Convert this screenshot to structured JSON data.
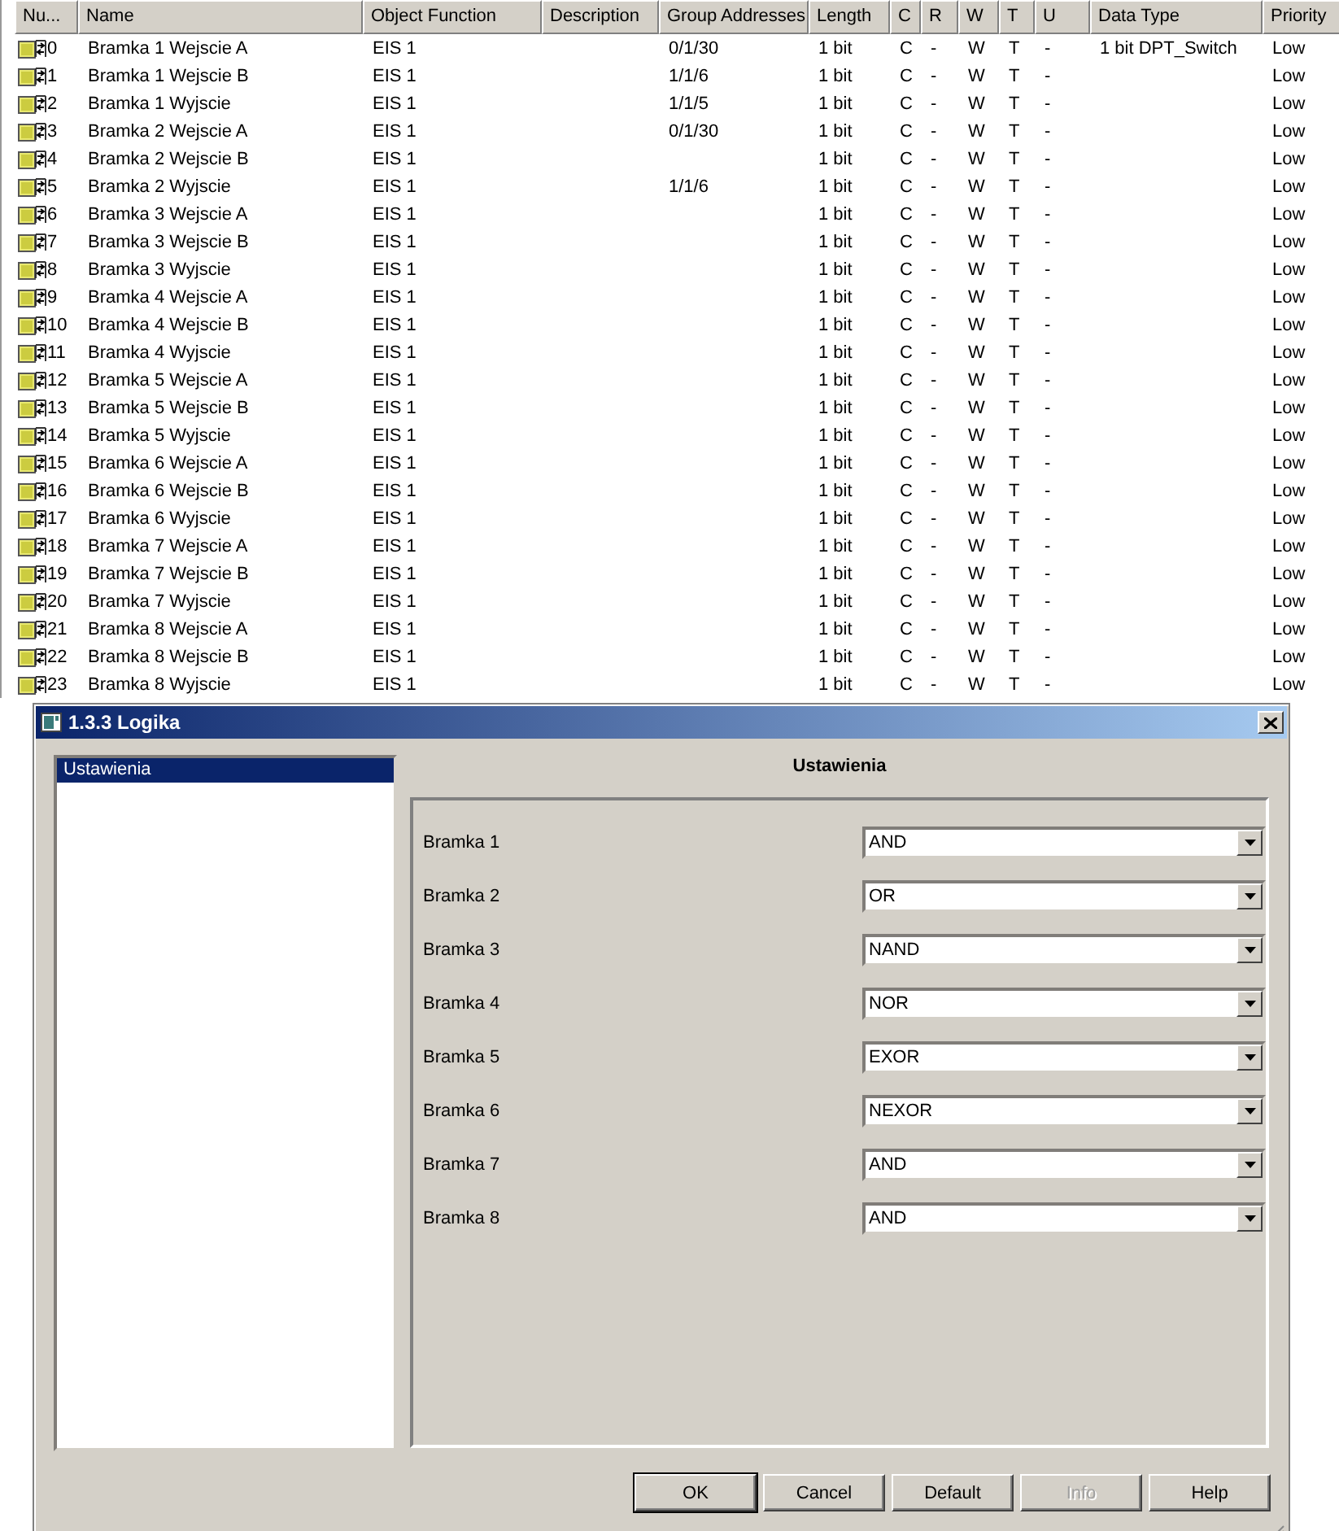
{
  "table": {
    "columns": [
      "Nu...",
      "Name",
      "Object Function",
      "Description",
      "Group Addresses",
      "Length",
      "C",
      "R",
      "W",
      "T",
      "U",
      "Data Type",
      "Priority"
    ],
    "rows": [
      {
        "number": "0",
        "name": "Bramka 1 Wejscie A",
        "function": "EIS 1",
        "group_addresses": "0/1/30",
        "length": "1 bit",
        "c": "C",
        "r": "-",
        "w": "W",
        "t": "T",
        "u": "-",
        "data_type": "1 bit DPT_Switch",
        "priority": "Low"
      },
      {
        "number": "1",
        "name": "Bramka 1 Wejscie B",
        "function": "EIS 1",
        "group_addresses": "1/1/6",
        "length": "1 bit",
        "c": "C",
        "r": "-",
        "w": "W",
        "t": "T",
        "u": "-",
        "priority": "Low"
      },
      {
        "number": "2",
        "name": "Bramka 1 Wyjscie",
        "function": "EIS 1",
        "group_addresses": "1/1/5",
        "length": "1 bit",
        "c": "C",
        "r": "-",
        "w": "W",
        "t": "T",
        "u": "-",
        "priority": "Low"
      },
      {
        "number": "3",
        "name": "Bramka 2 Wejscie A",
        "function": "EIS 1",
        "group_addresses": "0/1/30",
        "length": "1 bit",
        "c": "C",
        "r": "-",
        "w": "W",
        "t": "T",
        "u": "-",
        "priority": "Low"
      },
      {
        "number": "4",
        "name": "Bramka 2 Wejscie B",
        "function": "EIS 1",
        "length": "1 bit",
        "c": "C",
        "r": "-",
        "w": "W",
        "t": "T",
        "u": "-",
        "priority": "Low"
      },
      {
        "number": "5",
        "name": "Bramka 2 Wyjscie",
        "function": "EIS 1",
        "group_addresses": "1/1/6",
        "length": "1 bit",
        "c": "C",
        "r": "-",
        "w": "W",
        "t": "T",
        "u": "-",
        "priority": "Low"
      },
      {
        "number": "6",
        "name": "Bramka 3 Wejscie A",
        "function": "EIS 1",
        "length": "1 bit",
        "c": "C",
        "r": "-",
        "w": "W",
        "t": "T",
        "u": "-",
        "priority": "Low"
      },
      {
        "number": "7",
        "name": "Bramka 3 Wejscie B",
        "function": "EIS 1",
        "length": "1 bit",
        "c": "C",
        "r": "-",
        "w": "W",
        "t": "T",
        "u": "-",
        "priority": "Low"
      },
      {
        "number": "8",
        "name": "Bramka 3 Wyjscie",
        "function": "EIS 1",
        "length": "1 bit",
        "c": "C",
        "r": "-",
        "w": "W",
        "t": "T",
        "u": "-",
        "priority": "Low"
      },
      {
        "number": "9",
        "name": "Bramka 4 Wejscie A",
        "function": "EIS 1",
        "length": "1 bit",
        "c": "C",
        "r": "-",
        "w": "W",
        "t": "T",
        "u": "-",
        "priority": "Low"
      },
      {
        "number": "10",
        "name": "Bramka 4 Wejscie B",
        "function": "EIS 1",
        "length": "1 bit",
        "c": "C",
        "r": "-",
        "w": "W",
        "t": "T",
        "u": "-",
        "priority": "Low"
      },
      {
        "number": "11",
        "name": "Bramka 4 Wyjscie",
        "function": "EIS 1",
        "length": "1 bit",
        "c": "C",
        "r": "-",
        "w": "W",
        "t": "T",
        "u": "-",
        "priority": "Low"
      },
      {
        "number": "12",
        "name": "Bramka 5 Wejscie A",
        "function": "EIS 1",
        "length": "1 bit",
        "c": "C",
        "r": "-",
        "w": "W",
        "t": "T",
        "u": "-",
        "priority": "Low"
      },
      {
        "number": "13",
        "name": "Bramka 5 Wejscie B",
        "function": "EIS 1",
        "length": "1 bit",
        "c": "C",
        "r": "-",
        "w": "W",
        "t": "T",
        "u": "-",
        "priority": "Low"
      },
      {
        "number": "14",
        "name": "Bramka 5 Wyjscie",
        "function": "EIS 1",
        "length": "1 bit",
        "c": "C",
        "r": "-",
        "w": "W",
        "t": "T",
        "u": "-",
        "priority": "Low"
      },
      {
        "number": "15",
        "name": "Bramka 6 Wejscie A",
        "function": "EIS 1",
        "length": "1 bit",
        "c": "C",
        "r": "-",
        "w": "W",
        "t": "T",
        "u": "-",
        "priority": "Low"
      },
      {
        "number": "16",
        "name": "Bramka 6 Wejscie B",
        "function": "EIS 1",
        "length": "1 bit",
        "c": "C",
        "r": "-",
        "w": "W",
        "t": "T",
        "u": "-",
        "priority": "Low"
      },
      {
        "number": "17",
        "name": "Bramka 6 Wyjscie",
        "function": "EIS 1",
        "length": "1 bit",
        "c": "C",
        "r": "-",
        "w": "W",
        "t": "T",
        "u": "-",
        "priority": "Low"
      },
      {
        "number": "18",
        "name": "Bramka 7 Wejscie A",
        "function": "EIS 1",
        "length": "1 bit",
        "c": "C",
        "r": "-",
        "w": "W",
        "t": "T",
        "u": "-",
        "priority": "Low"
      },
      {
        "number": "19",
        "name": "Bramka 7 Wejscie B",
        "function": "EIS 1",
        "length": "1 bit",
        "c": "C",
        "r": "-",
        "w": "W",
        "t": "T",
        "u": "-",
        "priority": "Low"
      },
      {
        "number": "20",
        "name": "Bramka 7 Wyjscie",
        "function": "EIS 1",
        "length": "1 bit",
        "c": "C",
        "r": "-",
        "w": "W",
        "t": "T",
        "u": "-",
        "priority": "Low"
      },
      {
        "number": "21",
        "name": "Bramka 8 Wejscie A",
        "function": "EIS 1",
        "length": "1 bit",
        "c": "C",
        "r": "-",
        "w": "W",
        "t": "T",
        "u": "-",
        "priority": "Low"
      },
      {
        "number": "22",
        "name": "Bramka 8 Wejscie B",
        "function": "EIS 1",
        "length": "1 bit",
        "c": "C",
        "r": "-",
        "w": "W",
        "t": "T",
        "u": "-",
        "priority": "Low"
      },
      {
        "number": "23",
        "name": "Bramka 8 Wyjscie",
        "function": "EIS 1",
        "length": "1 bit",
        "c": "C",
        "r": "-",
        "w": "W",
        "t": "T",
        "u": "-",
        "priority": "Low"
      }
    ]
  },
  "dialog": {
    "title": "1.3.3 Logika",
    "sidebar": {
      "items": [
        {
          "label": "Ustawienia",
          "selected": true
        }
      ]
    },
    "heading": "Ustawienia",
    "settings": [
      {
        "label": "Bramka 1",
        "value": "AND"
      },
      {
        "label": "Bramka 2",
        "value": "OR"
      },
      {
        "label": "Bramka 3",
        "value": "NAND"
      },
      {
        "label": "Bramka 4",
        "value": "NOR"
      },
      {
        "label": "Bramka 5",
        "value": "EXOR"
      },
      {
        "label": "Bramka 6",
        "value": "NEXOR"
      },
      {
        "label": "Bramka 7",
        "value": "AND"
      },
      {
        "label": "Bramka 8",
        "value": "AND"
      }
    ],
    "buttons": [
      {
        "label": "OK",
        "default": true,
        "disabled": false
      },
      {
        "label": "Cancel",
        "default": false,
        "disabled": false
      },
      {
        "label": "Default",
        "default": false,
        "disabled": false
      },
      {
        "label": "Info",
        "default": false,
        "disabled": true
      },
      {
        "label": "Help",
        "default": false,
        "disabled": false
      }
    ]
  }
}
